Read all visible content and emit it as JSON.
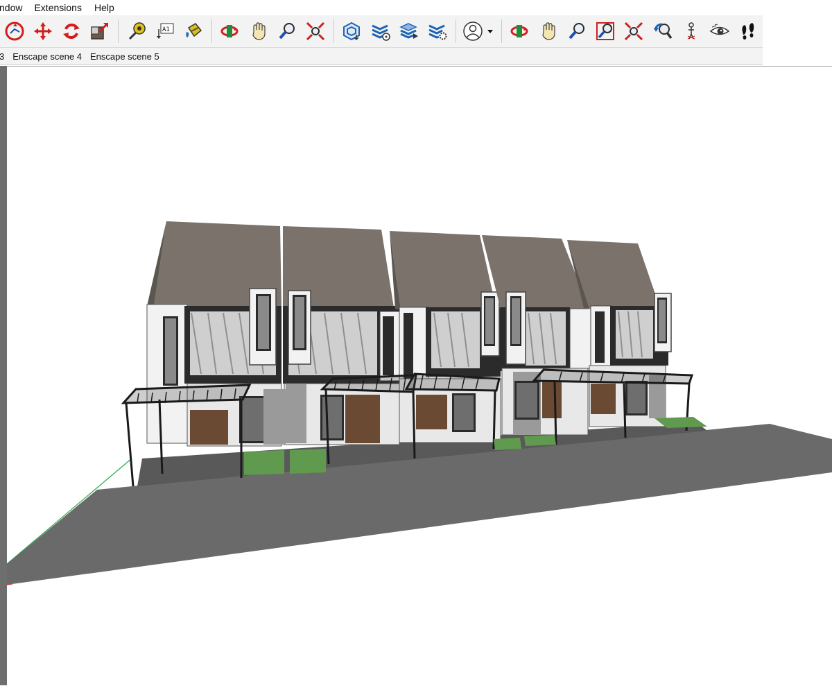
{
  "menubar": {
    "items": [
      "ndow",
      "Extensions",
      "Help"
    ]
  },
  "toolbar": {
    "groups": [
      [
        "follow-me-icon",
        "move-icon",
        "rotate-icon",
        "scale-icon"
      ],
      [
        "tape-measure-icon",
        "text-icon",
        "paint-bucket-icon"
      ],
      [
        "orbit-icon",
        "pan-icon",
        "zoom-icon",
        "zoom-extents-icon"
      ],
      [
        "warehouse-icon",
        "extension-warehouse-icon",
        "layers-share-icon",
        "layers-settings-icon"
      ],
      [
        "profile-icon"
      ],
      [
        "orbit-icon-2",
        "pan-icon-2",
        "zoom-icon-2",
        "zoom-window-icon",
        "zoom-extents-icon-2",
        "previous-view-icon",
        "position-camera-icon",
        "look-around-icon",
        "walk-icon"
      ]
    ]
  },
  "scenes": {
    "tabs": [
      "3",
      "Enscape scene 4",
      "Enscape scene 5"
    ]
  },
  "colors": {
    "roof": "#7a726b",
    "wall_white": "#f2f2f2",
    "dark_trim": "#2b2b2b",
    "wood": "#6b4a33",
    "stone": "#9a9a9a",
    "ground": "#5e5e5e",
    "road": "#6a6a6a",
    "grass": "#5f9a4f",
    "axis_green": "#2fa84f",
    "axis_red": "#d23a3a"
  }
}
